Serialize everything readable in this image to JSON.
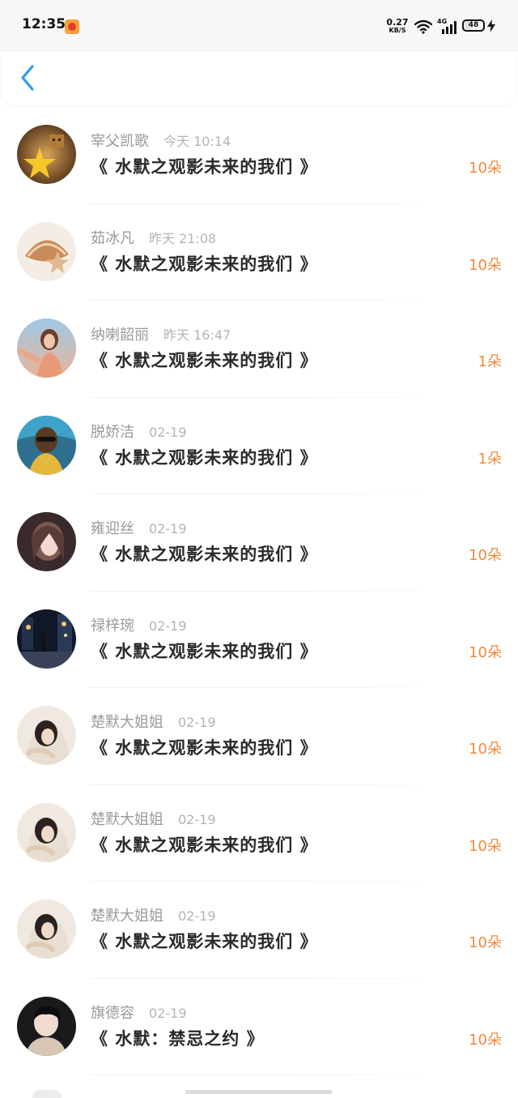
{
  "status_bar": {
    "time": "12:35",
    "net_speed": "0.27",
    "net_speed_unit": "KB/S",
    "network_type": "4G",
    "battery_level": "48",
    "battery_fraction": 0.48
  },
  "header": {
    "back_icon": "chevron-left-icon",
    "accent_color": "#2f9be8"
  },
  "gift_list": [
    {
      "sender": "宰父凯歌",
      "time": "今天 10:14",
      "title": "《 水默之观影未来的我们 》",
      "count": "10朵",
      "avatar": "avatar-star-doll"
    },
    {
      "sender": "茹冰凡",
      "time": "昨天 21:08",
      "title": "《 水默之观影未来的我们 》",
      "count": "10朵",
      "avatar": "avatar-shell"
    },
    {
      "sender": "纳喇韶丽",
      "time": "昨天 16:47",
      "title": "《 水默之观影未来的我们 》",
      "count": "1朵",
      "avatar": "avatar-girl-beach"
    },
    {
      "sender": "脱娇洁",
      "time": "02-19",
      "title": "《 水默之观影未来的我们 》",
      "count": "1朵",
      "avatar": "avatar-man-sunglasses"
    },
    {
      "sender": "雍迎丝",
      "time": "02-19",
      "title": "《 水默之观影未来的我们 》",
      "count": "10朵",
      "avatar": "avatar-girl-dark"
    },
    {
      "sender": "禄梓琬",
      "time": "02-19",
      "title": "《 水默之观影未来的我们 》",
      "count": "10朵",
      "avatar": "avatar-night-street"
    },
    {
      "sender": "楚默大姐姐",
      "time": "02-19",
      "title": "《 水默之观影未来的我们 》",
      "count": "10朵",
      "avatar": "avatar-girl-hoodie"
    },
    {
      "sender": "楚默大姐姐",
      "time": "02-19",
      "title": "《 水默之观影未来的我们 》",
      "count": "10朵",
      "avatar": "avatar-girl-hoodie"
    },
    {
      "sender": "楚默大姐姐",
      "time": "02-19",
      "title": "《 水默之观影未来的我们 》",
      "count": "10朵",
      "avatar": "avatar-girl-hoodie"
    },
    {
      "sender": "旗德容",
      "time": "02-19",
      "title": "《 水默：禁忌之约 》",
      "count": "10朵",
      "avatar": "avatar-boy"
    }
  ],
  "colors": {
    "name_text": "#9a9a9a",
    "time_text": "#b4b4b4",
    "title_text": "#2a2a2a",
    "count_text": "#f08a3c"
  }
}
